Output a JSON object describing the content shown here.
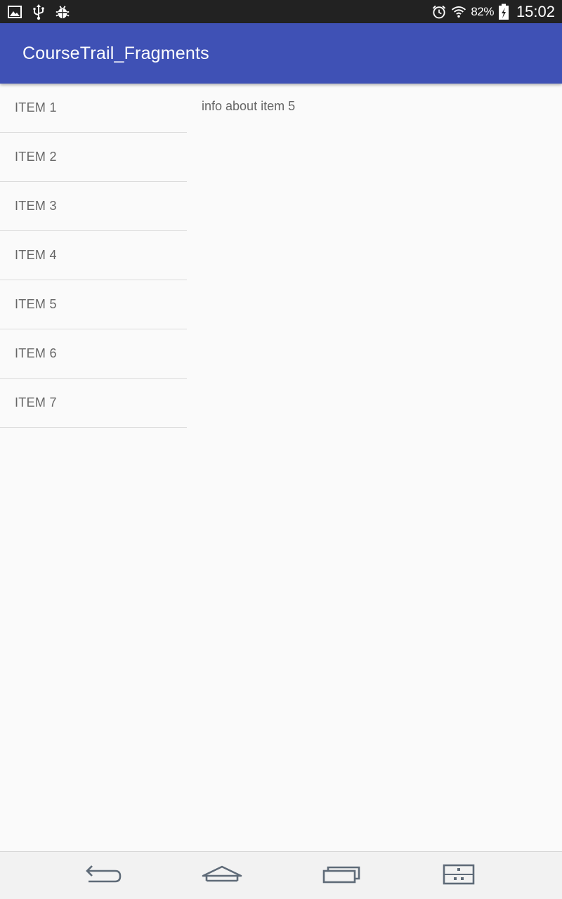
{
  "status_bar": {
    "left_icons": [
      "image-icon",
      "usb-icon",
      "debug-bug-icon"
    ],
    "alarm_icon": "alarm-icon",
    "wifi_icon": "wifi-icon",
    "battery_percent": "82%",
    "battery_icon": "battery-charging-icon",
    "time": "15:02",
    "background_color": "#222222"
  },
  "app_bar": {
    "title": "CourseTrail_Fragments",
    "color": "#3f51b5"
  },
  "list": {
    "items": [
      {
        "label": "ITEM 1"
      },
      {
        "label": "ITEM 2"
      },
      {
        "label": "ITEM 3"
      },
      {
        "label": "ITEM 4"
      },
      {
        "label": "ITEM 5"
      },
      {
        "label": "ITEM 6"
      },
      {
        "label": "ITEM 7"
      }
    ]
  },
  "detail": {
    "text": "info about item 5"
  },
  "nav_bar": {
    "buttons": [
      "back-icon",
      "home-icon",
      "recent-apps-icon",
      "keyboard-icon"
    ]
  }
}
